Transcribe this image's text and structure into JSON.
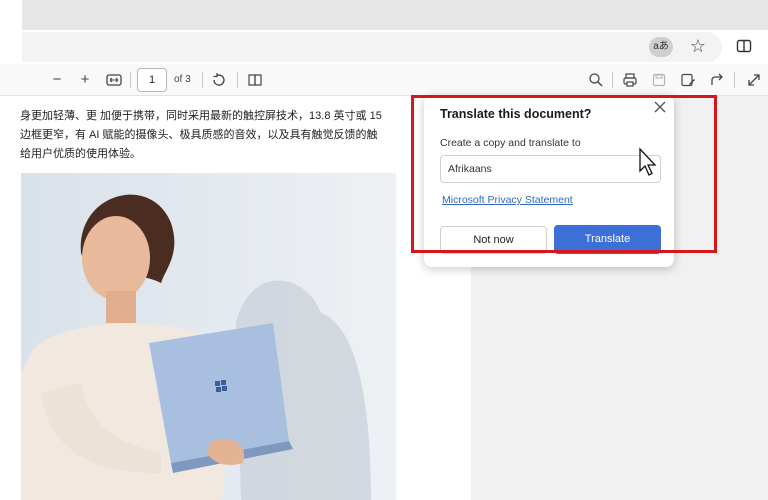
{
  "browser": {
    "read_aloud_label": "aあ",
    "favorite_icon": "star-icon",
    "split_icon": "split-screen-icon"
  },
  "pdf_toolbar": {
    "zoom_out": "−",
    "zoom_in": "+",
    "page_number": "1",
    "page_total": "of 3"
  },
  "document": {
    "paragraph": [
      "身更加轻薄、更 加便于携带，同时采用最新的触控屏技术，13.8 英寸或 15",
      "边框更窄，有 AI 赋能的摄像头、极具质感的音效，以及具有触觉反馈的触",
      "给用户优质的使用体验。"
    ]
  },
  "translate_popup": {
    "title": "Translate this document?",
    "label": "Create a copy and translate to",
    "language": "Afrikaans",
    "privacy_link": "Microsoft Privacy Statement",
    "not_now": "Not now",
    "translate": "Translate"
  },
  "colors": {
    "accent": "#3c6fd8",
    "highlight": "#d7161b",
    "link": "#2f6bc5"
  }
}
